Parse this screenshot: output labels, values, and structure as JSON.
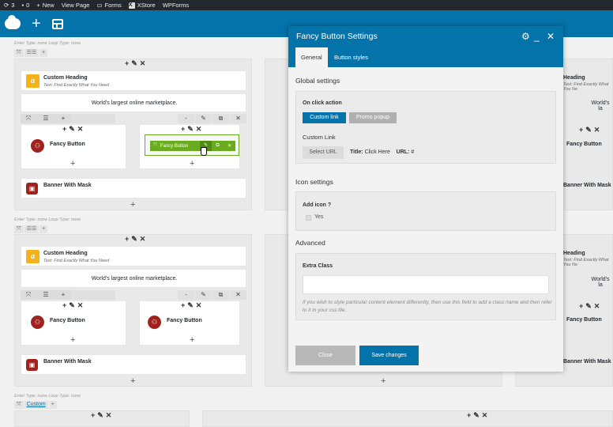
{
  "wp_bar": {
    "updates": "3",
    "comments": "0",
    "new": "New",
    "view_page": "View Page",
    "forms": "Forms",
    "xstore": "XStore",
    "wpforms": "WPForms"
  },
  "rows": {
    "row_label": "Enter Type: none  Loop Type: none",
    "custom_btn": "Custom"
  },
  "elements": {
    "custom_heading": "Custom Heading",
    "heading_sub": "Text: Find Exactly What You Need",
    "marketplace": "World's largest online marketplace.",
    "fancy_button": "Fancy Button",
    "banner_mask": "Banner With Mask",
    "heading_cut": "Heading",
    "heading_sub_cut": "Text: Find Exactly What You Ne",
    "marketplace_cut": "World's la"
  },
  "hover_toolbar": {
    "label": "Fancy Button"
  },
  "modal": {
    "title": "Fancy Button Settings",
    "tabs": [
      "General",
      "Button styles"
    ],
    "global_settings": "Global settings",
    "on_click": "On click action",
    "custom_link_btn": "Custom link",
    "promo_popup_btn": "Promo popup",
    "custom_link": "Custom Link",
    "select_url": "Select URL",
    "title_label": "Title:",
    "title_value": "Click Here",
    "url_label": "URL:",
    "url_value": "#",
    "icon_settings": "Icon settings",
    "add_icon": "Add icon ?",
    "yes": "Yes",
    "advanced": "Advanced",
    "extra_class": "Extra Class",
    "extra_class_value": "",
    "help": "If you wish to style particular content element differently, then use this field to add a class name and then refer to it in your css file.",
    "close": "Close",
    "save": "Save changes"
  },
  "colors": {
    "wp_blue": "#0473aa",
    "accent_green": "#6aac1f",
    "heading_icon": "#f5b21b",
    "button_icon": "#a0221c"
  }
}
